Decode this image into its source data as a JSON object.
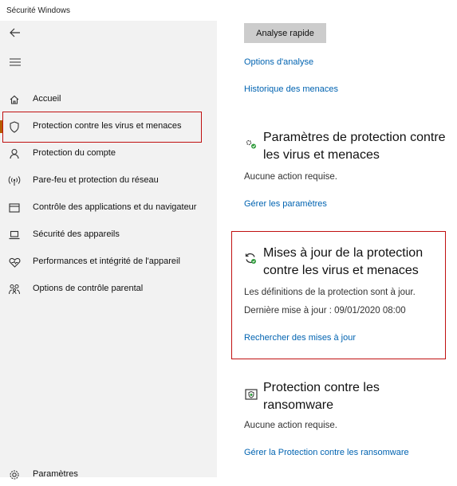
{
  "window": {
    "title": "Sécurité Windows"
  },
  "sidebar": {
    "items": [
      {
        "label": "Accueil",
        "icon": "home-icon"
      },
      {
        "label": "Protection contre les virus et menaces",
        "icon": "shield-icon",
        "active": true
      },
      {
        "label": "Protection du compte",
        "icon": "person-icon"
      },
      {
        "label": "Pare-feu et protection du réseau",
        "icon": "antenna-icon"
      },
      {
        "label": "Contrôle des applications et du navigateur",
        "icon": "app-window-icon"
      },
      {
        "label": "Sécurité des appareils",
        "icon": "laptop-icon"
      },
      {
        "label": "Performances et intégrité de l'appareil",
        "icon": "heart-icon"
      },
      {
        "label": "Options de contrôle parental",
        "icon": "family-icon"
      }
    ],
    "settings_label": "Paramètres"
  },
  "main": {
    "quick_scan_label": "Analyse rapide",
    "scan_options_link": "Options d'analyse",
    "threat_history_link": "Historique des menaces",
    "settings_section": {
      "title_line1": "Paramètres de protection contre",
      "title_line2": "les virus et menaces",
      "status": "Aucune action requise.",
      "link": "Gérer les paramètres"
    },
    "updates_section": {
      "title_line1": "Mises à jour de la protection",
      "title_line2": "contre les virus et menaces",
      "status": "Les définitions de la protection sont à jour.",
      "last_update": "Dernière mise à jour : 09/01/2020 08:00",
      "link": "Rechercher des mises à jour"
    },
    "ransomware_section": {
      "title_line1": "Protection contre les",
      "title_line2": "ransomware",
      "status": "Aucune action requise.",
      "link": "Gérer la Protection contre les ransomware"
    }
  },
  "colors": {
    "accent": "#b45c00",
    "link": "#0063b1",
    "highlight_box": "#c01010",
    "sidebar_bg": "#f2f2f2",
    "button_bg": "#cccccc"
  }
}
